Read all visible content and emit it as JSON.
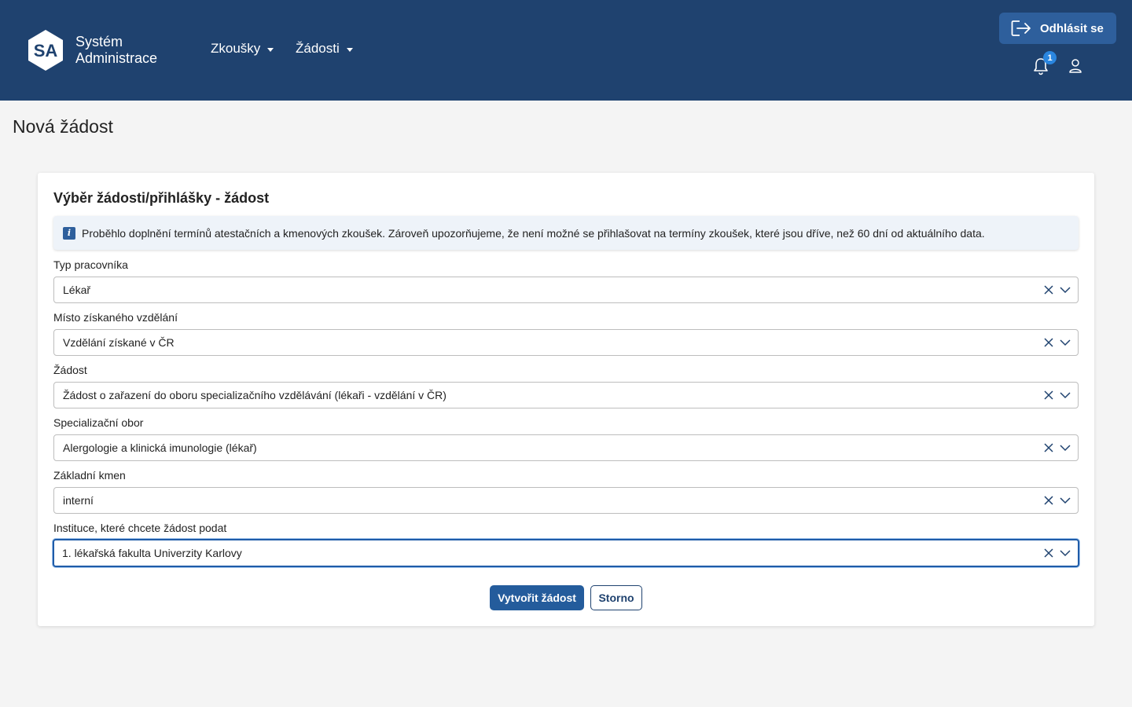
{
  "header": {
    "logo_text": "SA",
    "brand_line1": "Systém",
    "brand_line2": "Administrace",
    "nav": [
      {
        "label": "Zkoušky"
      },
      {
        "label": "Žádosti"
      }
    ],
    "logout_label": "Odhlásit se",
    "notification_count": "1",
    "icons": [
      "logout-icon",
      "bell-icon",
      "user-icon"
    ]
  },
  "page": {
    "title": "Nová žádost"
  },
  "card": {
    "title": "Výběr žádosti/přihlášky - žádost",
    "info_icon": "i",
    "info_text": "Proběhlo doplnění termínů atestačních a kmenových zkoušek. Zároveň upozorňujeme, že není možné se přihlašovat na termíny zkoušek, které jsou dříve, než 60 dní od aktuálního data.",
    "fields": [
      {
        "label": "Typ pracovníka",
        "value": "Lékař"
      },
      {
        "label": "Místo získaného vzdělání",
        "value": "Vzdělání získané v ČR"
      },
      {
        "label": "Žádost",
        "value": "Žádost o zařazení do oboru specializačního vzdělávání (lékaři - vzdělání v ČR)"
      },
      {
        "label": "Specializační obor",
        "value": "Alergologie a klinická imunologie (lékař)"
      },
      {
        "label": "Základní kmen",
        "value": "interní"
      },
      {
        "label": "Instituce, které chcete žádost podat",
        "value": "1. lékařská fakulta Univerzity Karlovy"
      }
    ],
    "submit_label": "Vytvořit žádost",
    "cancel_label": "Storno"
  },
  "colors": {
    "header_bg": "#1f426f",
    "primary": "#245c9c",
    "focus": "#1f5ca8",
    "badge": "#2a86e0"
  }
}
